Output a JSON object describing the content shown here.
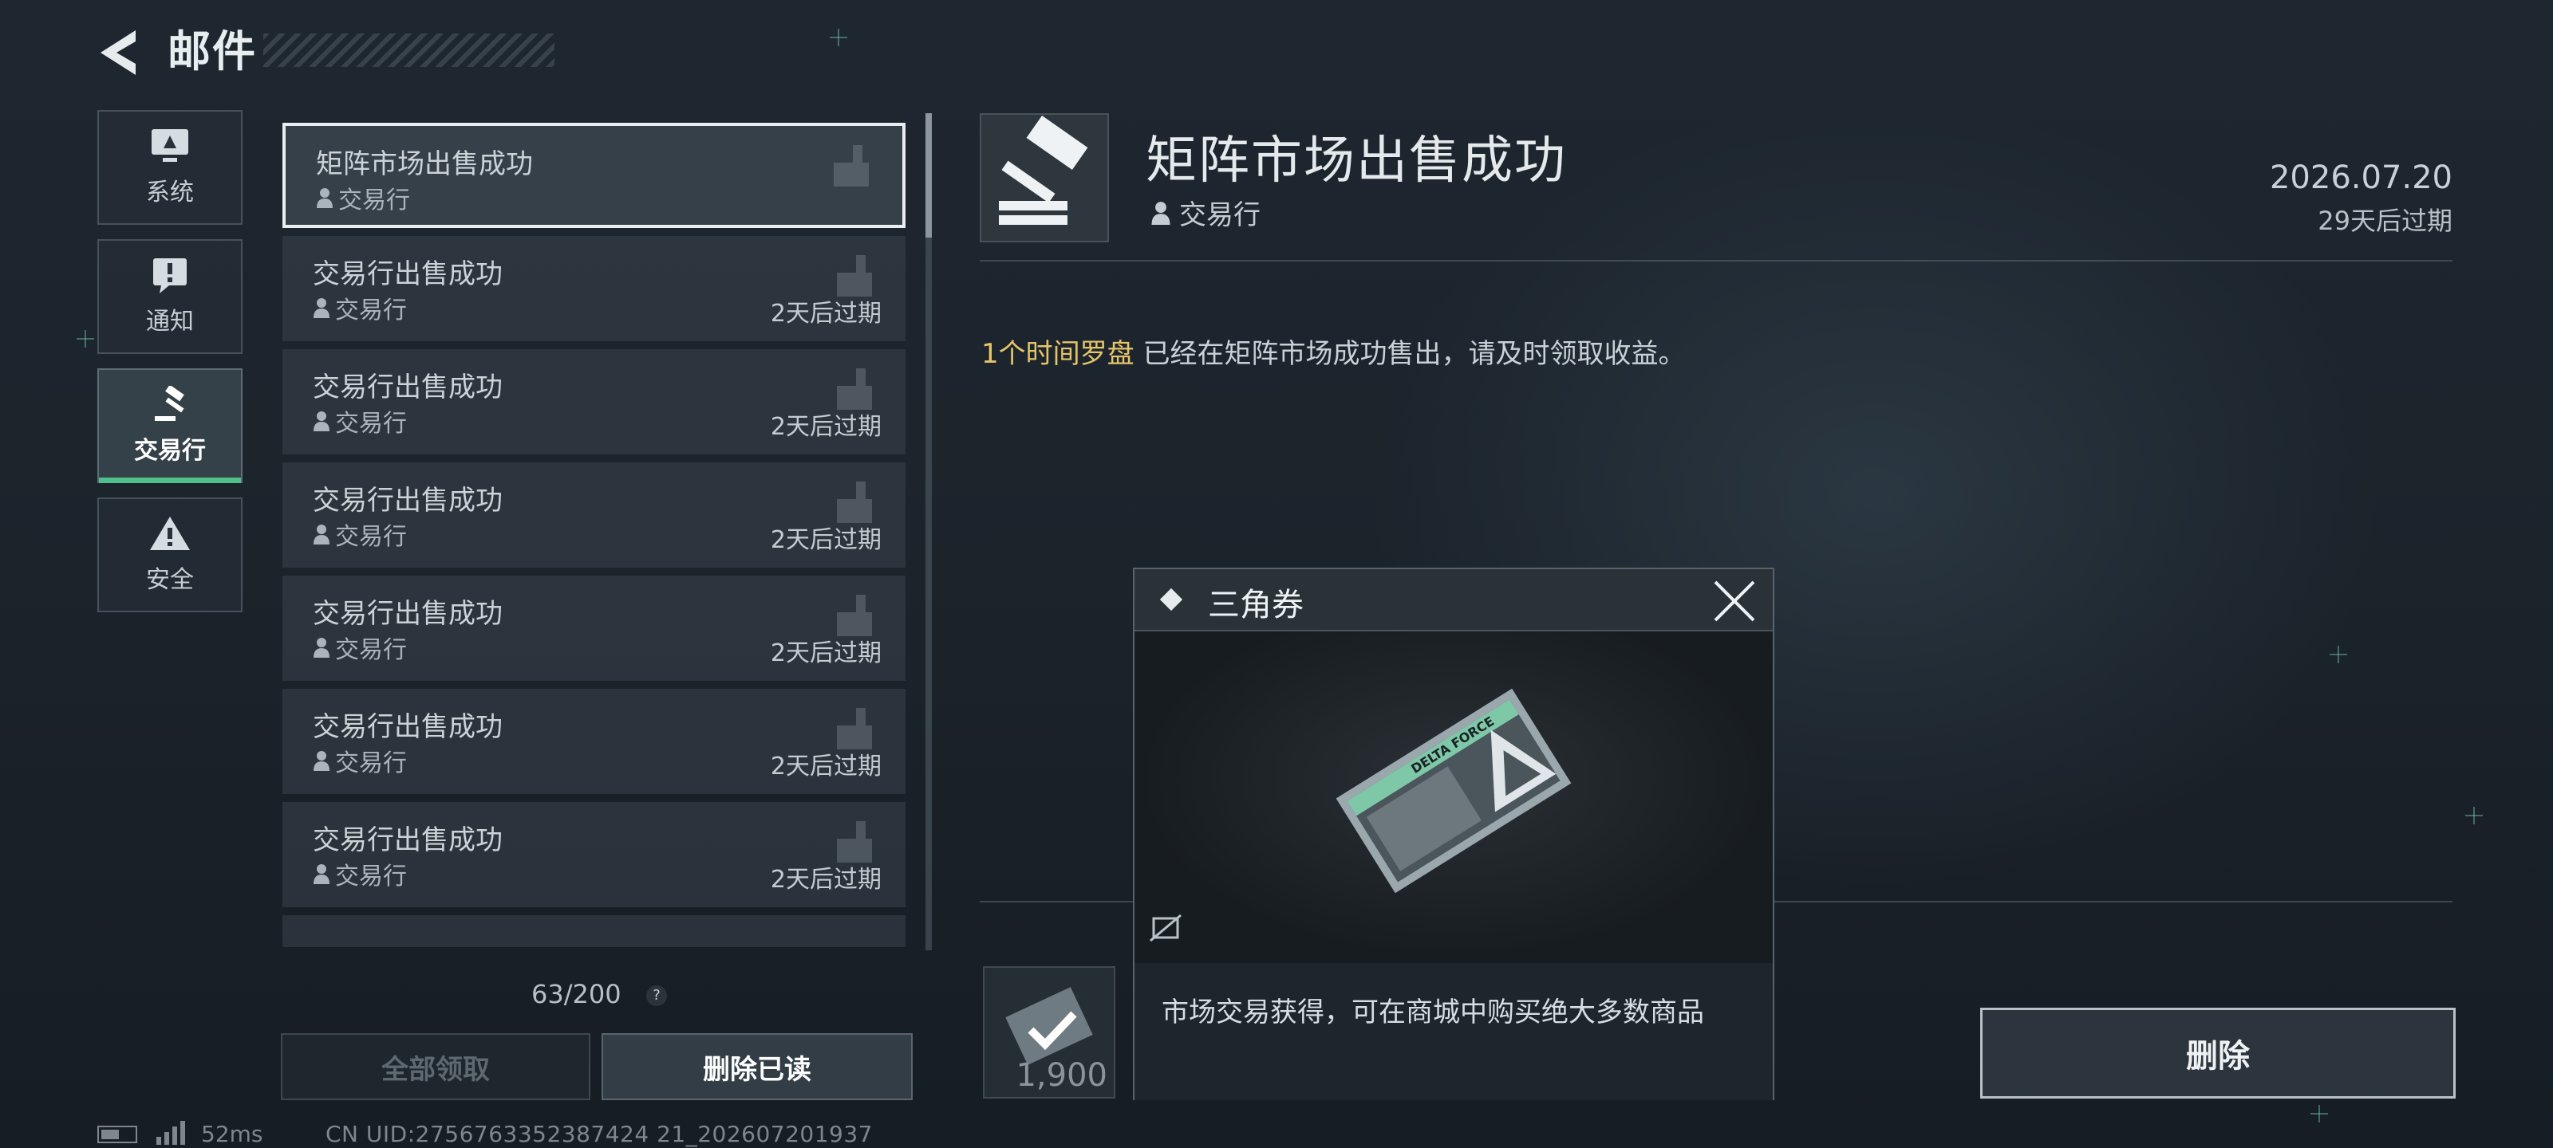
{
  "header": {
    "title": "邮件",
    "back_icon": "chevron-left-icon"
  },
  "categories": [
    {
      "label": "系统",
      "icon": "monitor-icon",
      "active": false
    },
    {
      "label": "通知",
      "icon": "exclamation-icon",
      "active": false
    },
    {
      "label": "交易行",
      "icon": "gavel-icon",
      "active": true
    },
    {
      "label": "安全",
      "icon": "warning-icon",
      "active": false
    }
  ],
  "mail_list": [
    {
      "title": "矩阵市场出售成功",
      "sender": "交易行",
      "expire": "",
      "selected": true
    },
    {
      "title": "交易行出售成功",
      "sender": "交易行",
      "expire": "2天后过期"
    },
    {
      "title": "交易行出售成功",
      "sender": "交易行",
      "expire": "2天后过期"
    },
    {
      "title": "交易行出售成功",
      "sender": "交易行",
      "expire": "2天后过期"
    },
    {
      "title": "交易行出售成功",
      "sender": "交易行",
      "expire": "2天后过期"
    },
    {
      "title": "交易行出售成功",
      "sender": "交易行",
      "expire": "2天后过期"
    },
    {
      "title": "交易行出售成功",
      "sender": "交易行",
      "expire": "2天后过期"
    }
  ],
  "mail_count": "63/200",
  "help_symbol": "?",
  "buttons": {
    "claim_all": "全部领取",
    "delete_read": "删除已读",
    "delete": "删除"
  },
  "status": {
    "ping": "52ms",
    "uid": "CN UID:2756763352387424 21_202607201937"
  },
  "detail": {
    "title": "矩阵市场出售成功",
    "sender": "交易行",
    "date": "2026.07.20",
    "expire": "29天后过期",
    "message_highlight": "1个时间罗盘",
    "message_rest": " 已经在矩阵市场成功售出，请及时领取收益。",
    "attachment_qty": "1,900"
  },
  "popup": {
    "title": "三角券",
    "description": "市场交易获得，可在商城中购买绝大多数商品",
    "card_text": "DELTA FORCE"
  },
  "colors": {
    "accent_green": "#4fc08a",
    "highlight_gold": "#e6c46a"
  }
}
